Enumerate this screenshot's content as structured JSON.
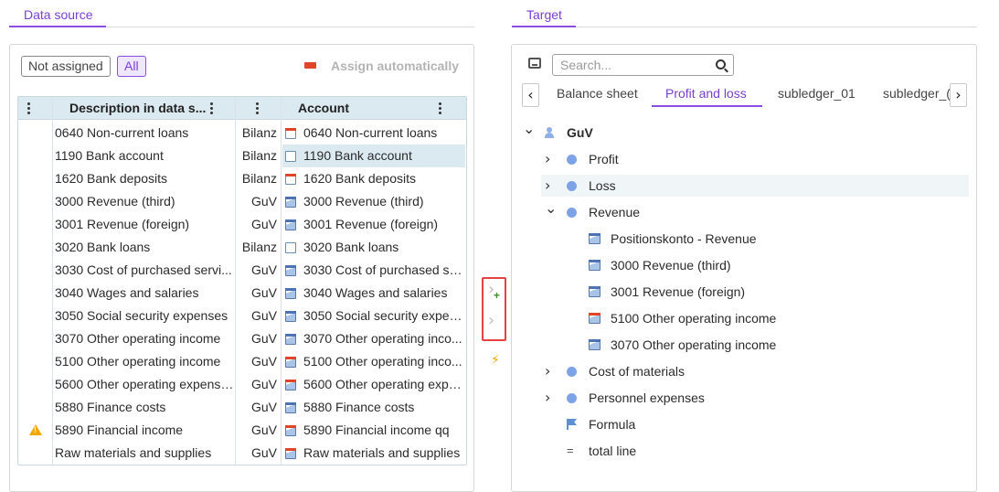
{
  "left": {
    "section_title": "Data source",
    "filters": {
      "not_assigned": "Not assigned",
      "all": "All"
    },
    "assign_automatically": "Assign automatically",
    "grid": {
      "headers": {
        "description": "Description in data s...",
        "account": "Account"
      },
      "rows": [
        {
          "desc": "0640 Non-current loans",
          "type": "Bilanz",
          "acc": "0640 Non-current loans",
          "icon": "red",
          "selected": false,
          "warn": false
        },
        {
          "desc": "1190 Bank account",
          "type": "Bilanz",
          "acc": "1190 Bank account",
          "icon": "plain",
          "selected": true,
          "warn": false
        },
        {
          "desc": "1620 Bank deposits",
          "type": "Bilanz",
          "acc": "1620 Bank deposits",
          "icon": "red",
          "selected": false,
          "warn": false
        },
        {
          "desc": "3000 Revenue (third)",
          "type": "GuV",
          "acc": "3000 Revenue (third)",
          "icon": "blue",
          "selected": false,
          "warn": false
        },
        {
          "desc": "3001 Revenue (foreign)",
          "type": "GuV",
          "acc": "3001 Revenue (foreign)",
          "icon": "blue",
          "selected": false,
          "warn": false
        },
        {
          "desc": "3020 Bank loans",
          "type": "Bilanz",
          "acc": "3020 Bank loans",
          "icon": "plain",
          "selected": false,
          "warn": false
        },
        {
          "desc": "3030 Cost of purchased servi...",
          "type": "GuV",
          "acc": "3030 Cost of purchased se...",
          "icon": "blue",
          "selected": false,
          "warn": false
        },
        {
          "desc": "3040 Wages and salaries",
          "type": "GuV",
          "acc": "3040 Wages and salaries",
          "icon": "blue",
          "selected": false,
          "warn": false
        },
        {
          "desc": "3050 Social security expenses",
          "type": "GuV",
          "acc": "3050 Social security expen...",
          "icon": "blue",
          "selected": false,
          "warn": false
        },
        {
          "desc": "3070 Other operating income",
          "type": "GuV",
          "acc": "3070 Other operating inco...",
          "icon": "blue",
          "selected": false,
          "warn": false
        },
        {
          "desc": "5100 Other operating income",
          "type": "GuV",
          "acc": "5100 Other operating inco...",
          "icon": "bluered",
          "selected": false,
          "warn": false
        },
        {
          "desc": "5600 Other operating expenses",
          "type": "GuV",
          "acc": "5600 Other operating expe...",
          "icon": "bluered",
          "selected": false,
          "warn": false
        },
        {
          "desc": "5880 Finance costs",
          "type": "GuV",
          "acc": "5880 Finance costs",
          "icon": "blue",
          "selected": false,
          "warn": false
        },
        {
          "desc": "5890 Financial income",
          "type": "GuV",
          "acc": "5890 Financial income qq",
          "icon": "bluered",
          "selected": false,
          "warn": true
        },
        {
          "desc": "Raw materials and supplies",
          "type": "GuV",
          "acc": "Raw materials and supplies",
          "icon": "bluered",
          "selected": false,
          "warn": false
        }
      ]
    }
  },
  "right": {
    "section_title": "Target",
    "search": {
      "placeholder": "Search..."
    },
    "tabs": [
      {
        "label": "Balance sheet",
        "active": false
      },
      {
        "label": "Profit and loss",
        "active": true
      },
      {
        "label": "subledger_01",
        "active": false
      },
      {
        "label": "subledger_(",
        "active": false
      }
    ],
    "tree": [
      {
        "label": "GuV",
        "level": 0,
        "twisty": "down",
        "icon": "person",
        "bold": true
      },
      {
        "label": "Profit",
        "level": 1,
        "twisty": "right",
        "icon": "dot"
      },
      {
        "label": "Loss",
        "level": 1,
        "twisty": "right",
        "icon": "dot",
        "highlight": true
      },
      {
        "label": "Revenue",
        "level": 1,
        "twisty": "down",
        "icon": "dot"
      },
      {
        "label": "Positionskonto - Revenue",
        "level": 2,
        "twisty": "",
        "icon": "account-blue"
      },
      {
        "label": "3000 Revenue (third)",
        "level": 2,
        "twisty": "",
        "icon": "account-blue"
      },
      {
        "label": "3001 Revenue (foreign)",
        "level": 2,
        "twisty": "",
        "icon": "account-blue"
      },
      {
        "label": "5100 Other operating income",
        "level": 2,
        "twisty": "",
        "icon": "account-red"
      },
      {
        "label": "3070 Other operating income",
        "level": 2,
        "twisty": "",
        "icon": "account-blue"
      },
      {
        "label": "Cost of materials",
        "level": 1,
        "twisty": "right",
        "icon": "dot"
      },
      {
        "label": "Personnel expenses",
        "level": 1,
        "twisty": "right",
        "icon": "dot"
      },
      {
        "label": "Formula",
        "level": 1,
        "twisty": "",
        "icon": "flag"
      },
      {
        "label": "total line",
        "level": 1,
        "twisty": "",
        "icon": "equals",
        "symbol": "="
      }
    ]
  },
  "middle": {
    "icons": [
      "chevron-right-add-icon",
      "chevron-right-icon",
      "lightning-icon"
    ]
  }
}
